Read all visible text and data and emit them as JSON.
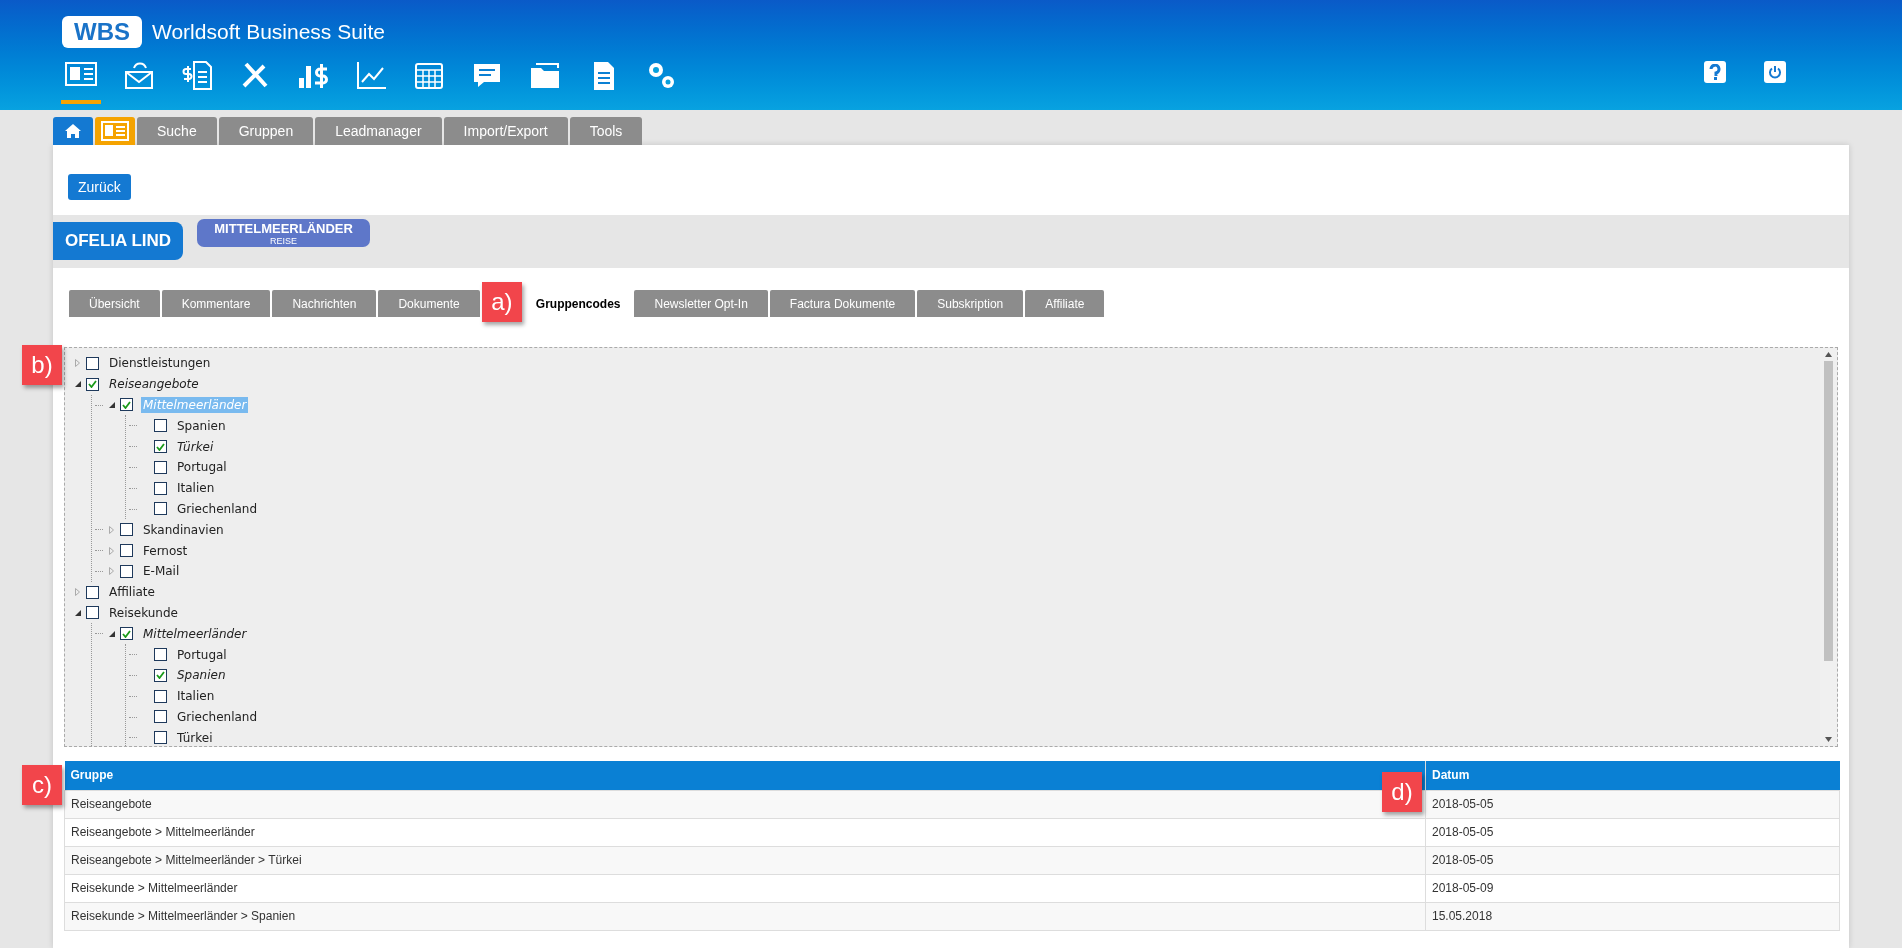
{
  "app": {
    "logo": "WBS",
    "title": "Worldsoft Business Suite"
  },
  "toolbar": [
    {
      "kind": "contacts",
      "selected": true
    },
    {
      "kind": "mail",
      "selected": false
    },
    {
      "kind": "invoice",
      "selected": false
    },
    {
      "kind": "tools",
      "selected": false
    },
    {
      "kind": "finance",
      "selected": false
    },
    {
      "kind": "chart",
      "selected": false
    },
    {
      "kind": "calendar",
      "selected": false
    },
    {
      "kind": "chat",
      "selected": false
    },
    {
      "kind": "gallery",
      "selected": false
    },
    {
      "kind": "document",
      "selected": false
    },
    {
      "kind": "settings",
      "selected": false
    }
  ],
  "top_right": [
    {
      "kind": "help"
    },
    {
      "kind": "power"
    }
  ],
  "main_tabs": [
    {
      "kind": "home",
      "selected": false
    },
    {
      "kind": "contacts",
      "selected": true
    },
    {
      "kind": "text",
      "label": "Suche",
      "selected": false
    },
    {
      "kind": "text",
      "label": "Gruppen",
      "selected": false
    },
    {
      "kind": "text",
      "label": "Leadmanager",
      "selected": false
    },
    {
      "kind": "text",
      "label": "Import/Export",
      "selected": false
    },
    {
      "kind": "text",
      "label": "Tools",
      "selected": false
    }
  ],
  "back_button": "Zurück",
  "contact": {
    "name": "OFELIA LIND",
    "group_badge": {
      "title": "MITTELMEERLÄNDER",
      "subtitle": "REISE"
    }
  },
  "sub_tabs": [
    {
      "label": "Übersicht",
      "selected": false
    },
    {
      "label": "Kommentare",
      "selected": false
    },
    {
      "label": "Nachrichten",
      "selected": false
    },
    {
      "label": "Dokumente",
      "selected": false
    },
    {
      "label": "Gruppencodes",
      "selected": true
    },
    {
      "label": "Newsletter Opt-In",
      "selected": false
    },
    {
      "label": "Factura Dokumente",
      "selected": false
    },
    {
      "label": "Subskription",
      "selected": false
    },
    {
      "label": "Affiliate",
      "selected": false
    }
  ],
  "tree": [
    {
      "label": "Dienstleistungen",
      "checked": false,
      "expanded": false
    },
    {
      "label": "Reiseangebote",
      "checked": true,
      "expanded": true,
      "children": [
        {
          "label": "Mittelmeerländer",
          "checked": true,
          "expanded": true,
          "selected": true,
          "children": [
            {
              "label": "Spanien",
              "checked": false
            },
            {
              "label": "Türkei",
              "checked": true
            },
            {
              "label": "Portugal",
              "checked": false
            },
            {
              "label": "Italien",
              "checked": false
            },
            {
              "label": "Griechenland",
              "checked": false
            }
          ]
        },
        {
          "label": "Skandinavien",
          "checked": false,
          "expanded": false
        },
        {
          "label": "Fernost",
          "checked": false,
          "expanded": false
        },
        {
          "label": "E-Mail",
          "checked": false,
          "expanded": false
        }
      ]
    },
    {
      "label": "Affiliate",
      "checked": false,
      "expanded": false
    },
    {
      "label": "Reisekunde",
      "checked": false,
      "expanded": true,
      "children": [
        {
          "label": "Mittelmeerländer",
          "checked": true,
          "expanded": true,
          "selected": false,
          "children": [
            {
              "label": "Portugal",
              "checked": false
            },
            {
              "label": "Spanien",
              "checked": true
            },
            {
              "label": "Italien",
              "checked": false
            },
            {
              "label": "Griechenland",
              "checked": false
            },
            {
              "label": "Türkei",
              "checked": false
            }
          ]
        }
      ]
    }
  ],
  "table": {
    "columns": [
      "Gruppe",
      "Datum"
    ],
    "rows": [
      [
        "Reiseangebote",
        "2018-05-05"
      ],
      [
        "Reiseangebote > Mittelmeerländer",
        "2018-05-05"
      ],
      [
        "Reiseangebote > Mittelmeerländer > Türkei",
        "2018-05-05"
      ],
      [
        "Reisekunde > Mittelmeerländer",
        "2018-05-09"
      ],
      [
        "Reisekunde > Mittelmeerländer > Spanien",
        "15.05.2018"
      ]
    ]
  },
  "callouts": [
    "a)",
    "b)",
    "c)",
    "d)"
  ]
}
